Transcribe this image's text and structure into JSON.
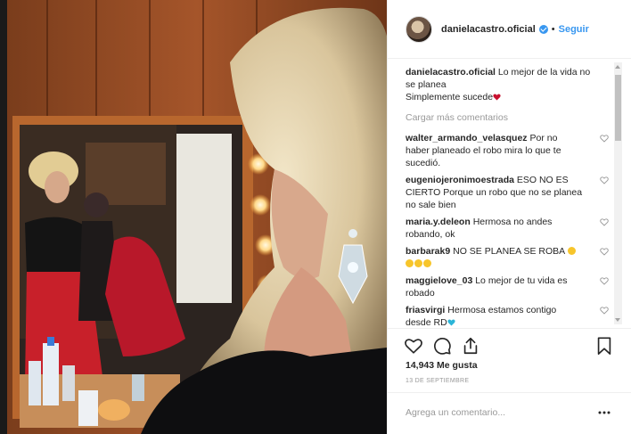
{
  "header": {
    "username": "danielacastro.oficial",
    "dot": "•",
    "follow_label": "Seguir"
  },
  "caption": {
    "username": "danielacastro.oficial",
    "line1": "Lo mejor de la vida no se planea",
    "line2": "Simplemente sucede"
  },
  "load_more_label": "Cargar más comentarios",
  "comments": [
    {
      "user": "walter_armando_velasquez",
      "text": "Por no haber planeado el robo mira lo que te sucedió."
    },
    {
      "user": "eugeniojeronimoestrada",
      "text": "ESO NO ES CIERTO Porque un robo que no se planea no sale bien"
    },
    {
      "user": "maria.y.deleon",
      "text": "Hermosa no andes robando, ok"
    },
    {
      "user": "barbarak9",
      "text": "NO SE PLANEA SE ROBA"
    },
    {
      "user": "maggielove_03",
      "text": "Lo mejor de tu vida es robado"
    },
    {
      "user": "friasvirgi",
      "text": "Hermosa estamos contigo desde RD"
    }
  ],
  "likes_label": "14,943 Me gusta",
  "date_label": "13 de septiembre",
  "add_comment_placeholder": "Agrega un comentario...",
  "icons": {
    "like": "heart-icon",
    "comment": "comment-bubble-icon",
    "share": "share-icon",
    "save": "bookmark-icon",
    "verified": "verified-badge-icon",
    "options": "more-options-icon"
  },
  "colors": {
    "accent": "#3897f0",
    "heart_red": "#e0245e",
    "heart_blue": "#2bb5d8",
    "muted": "#999999"
  }
}
